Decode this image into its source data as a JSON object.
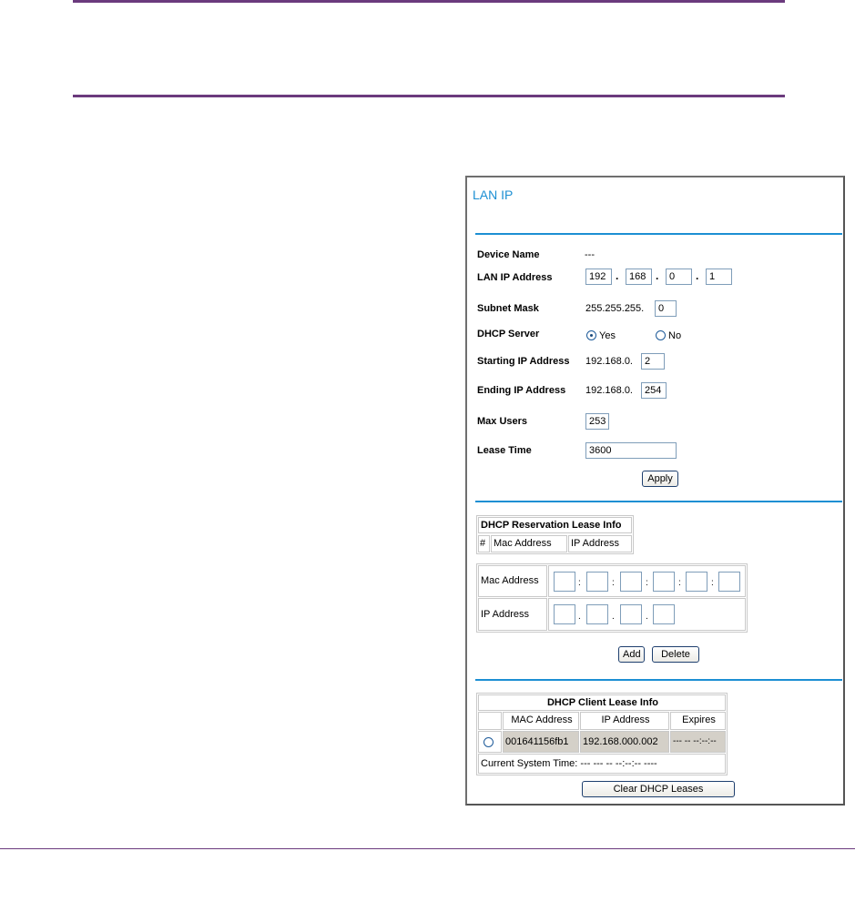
{
  "panel": {
    "title": "LAN IP",
    "fields": {
      "device_name_label": "Device Name",
      "device_name_value": "---",
      "lan_ip_label": "LAN IP Address",
      "lan_ip": [
        "192",
        "168",
        "0",
        "1"
      ],
      "subnet_label": "Subnet Mask",
      "subnet_prefix": "255.255.255.",
      "subnet_last": "0",
      "dhcp_label": "DHCP Server",
      "dhcp_yes": "Yes",
      "dhcp_no": "No",
      "dhcp_selected": "Yes",
      "start_label": "Starting IP Address",
      "start_prefix": "192.168.0.",
      "start_last": "2",
      "end_label": "Ending IP Address",
      "end_prefix": "192.168.0.",
      "end_last": "254",
      "max_label": "Max Users",
      "max_value": "253",
      "lease_label": "Lease Time",
      "lease_value": "3600",
      "apply": "Apply"
    },
    "reservation": {
      "title": "DHCP Reservation Lease Info",
      "col_num": "#",
      "col_mac": "Mac Address",
      "col_ip": "IP Address",
      "mac_label": "Mac Address",
      "ip_label": "IP Address",
      "mac_sep": ":",
      "ip_sep": ".",
      "add": "Add",
      "delete": "Delete"
    },
    "client": {
      "title": "DHCP Client Lease Info",
      "col_mac": "MAC Address",
      "col_ip": "IP Address",
      "col_expires": "Expires",
      "rows": [
        {
          "mac": "001641156fb1",
          "ip": "192.168.000.002",
          "expires": "--- -- --:--:--"
        }
      ],
      "system_time": "Current System Time: --- --- -- --:--:-- ----",
      "clear": "Clear DHCP Leases"
    }
  },
  "colors": {
    "accent": "#1c8fd3",
    "rule": "#6b3a7d"
  }
}
